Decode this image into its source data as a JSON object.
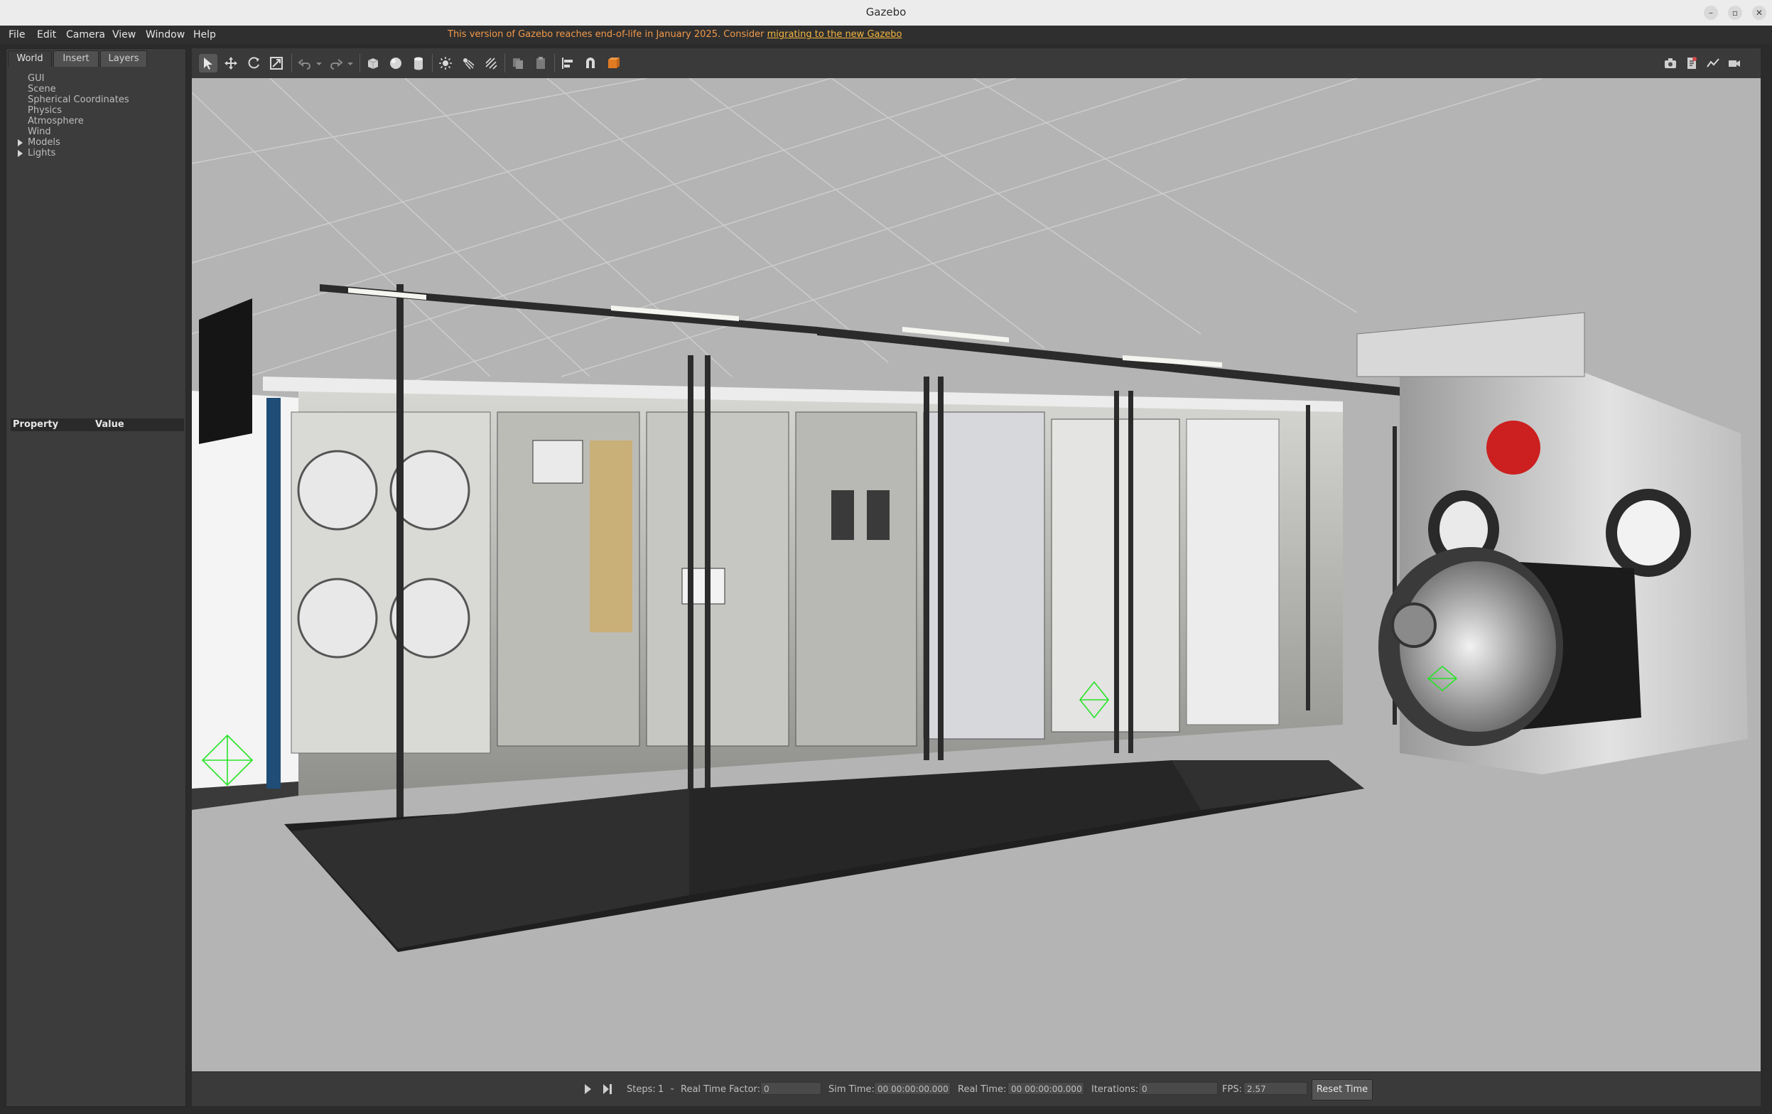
{
  "window": {
    "title": "Gazebo"
  },
  "menu": [
    "File",
    "Edit",
    "Camera",
    "View",
    "Window",
    "Help"
  ],
  "notice": {
    "text": "This version of Gazebo reaches end-of-life in January 2025. Consider",
    "link": "migrating to the new Gazebo",
    "color": "#f2994a"
  },
  "left_panel": {
    "tabs": [
      "World",
      "Insert",
      "Layers"
    ],
    "active_tab": "World",
    "tree": [
      "GUI",
      "Scene",
      "Spherical Coordinates",
      "Physics",
      "Atmosphere",
      "Wind",
      "Models",
      "Lights"
    ],
    "expandable": [
      "Models",
      "Lights"
    ],
    "properties_header": {
      "property": "Property",
      "value": "Value"
    }
  },
  "toolbar": {
    "tools": [
      "select-arrow-icon",
      "translate-icon",
      "rotate-icon",
      "scale-icon",
      "undo-icon",
      "redo-icon",
      "box-icon",
      "sphere-icon",
      "cylinder-icon",
      "point-light-icon",
      "spot-light-icon",
      "directional-light-icon",
      "copy-icon",
      "paste-icon",
      "align-icon",
      "snap-icon",
      "change-view-icon"
    ],
    "active_tool": "select-arrow-icon",
    "right_tools": [
      "screenshot-icon",
      "log-icon",
      "plot-icon",
      "video-icon"
    ]
  },
  "bottom_bar": {
    "steps_label": "Steps:",
    "steps_value": "1",
    "rtf_label": "Real Time Factor:",
    "rtf_value": "0",
    "sim_time_label": "Sim Time:",
    "sim_time_value": "00 00:00:00.000",
    "real_time_label": "Real Time:",
    "real_time_value": "00 00:00:00.000",
    "iterations_label": "Iterations:",
    "iterations_value": "0",
    "fps_label": "FPS:",
    "fps_value": "2.57",
    "reset_label": "Reset Time"
  }
}
